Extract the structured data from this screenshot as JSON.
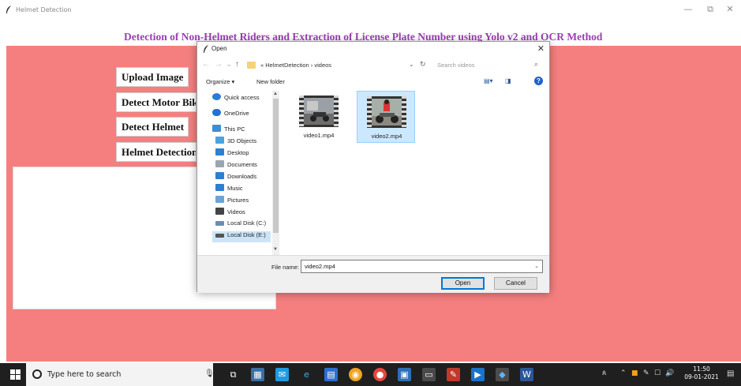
{
  "window": {
    "title": "Helmet Detection",
    "controls": {
      "minimize": "—",
      "restore": "⧉",
      "close": "✕"
    }
  },
  "app": {
    "heading": "Detection of Non-Helmet Riders and Extraction of License Plate Number using Yolo v2 and OCR Method",
    "buttons": [
      "Upload Image",
      "Detect Motor Bike",
      "Detect Helmet",
      "Helmet Detection from Video"
    ]
  },
  "dialog": {
    "title": "Open",
    "close": "✕",
    "breadcrumb": "«  HelmetDetection  ›  videos",
    "search_placeholder": "Search videos",
    "organize_label": "Organize ▾",
    "new_folder_label": "New folder",
    "nav_items": [
      {
        "label": "Quick access",
        "icon": "star-icon",
        "color": "#2b7cd3"
      },
      {
        "label": "OneDrive",
        "icon": "cloud-icon",
        "color": "#1e73d8"
      },
      {
        "label": "This PC",
        "icon": "computer-icon",
        "color": "#3a8fd9"
      },
      {
        "label": "3D Objects",
        "icon": "cube-icon",
        "color": "#4aa3df"
      },
      {
        "label": "Desktop",
        "icon": "desktop-icon",
        "color": "#2d7fd2"
      },
      {
        "label": "Documents",
        "icon": "document-icon",
        "color": "#9aa5b1"
      },
      {
        "label": "Downloads",
        "icon": "download-icon",
        "color": "#2d7fd2"
      },
      {
        "label": "Music",
        "icon": "music-icon",
        "color": "#2d7fd2"
      },
      {
        "label": "Pictures",
        "icon": "pictures-icon",
        "color": "#6fa3d6"
      },
      {
        "label": "Videos",
        "icon": "video-icon",
        "color": "#444"
      },
      {
        "label": "Local Disk (C:)",
        "icon": "disk-icon",
        "color": "#6b8fb3"
      },
      {
        "label": "Local Disk (E:)",
        "icon": "disk-icon",
        "color": "#555"
      }
    ],
    "files": [
      {
        "name": "video1.mp4",
        "selected": false
      },
      {
        "name": "video2.mp4",
        "selected": true
      }
    ],
    "file_name_label": "File name:",
    "file_name_value": "video2.mp4",
    "open_button": "Open",
    "cancel_button": "Cancel"
  },
  "taskbar": {
    "search_placeholder": "Type here to search",
    "clock_time": "11:50",
    "clock_date": "09-01-2021"
  },
  "colors": {
    "background": "#f57f7f",
    "heading": "#9b3fb3",
    "taskbar": "#1f1f1f"
  }
}
